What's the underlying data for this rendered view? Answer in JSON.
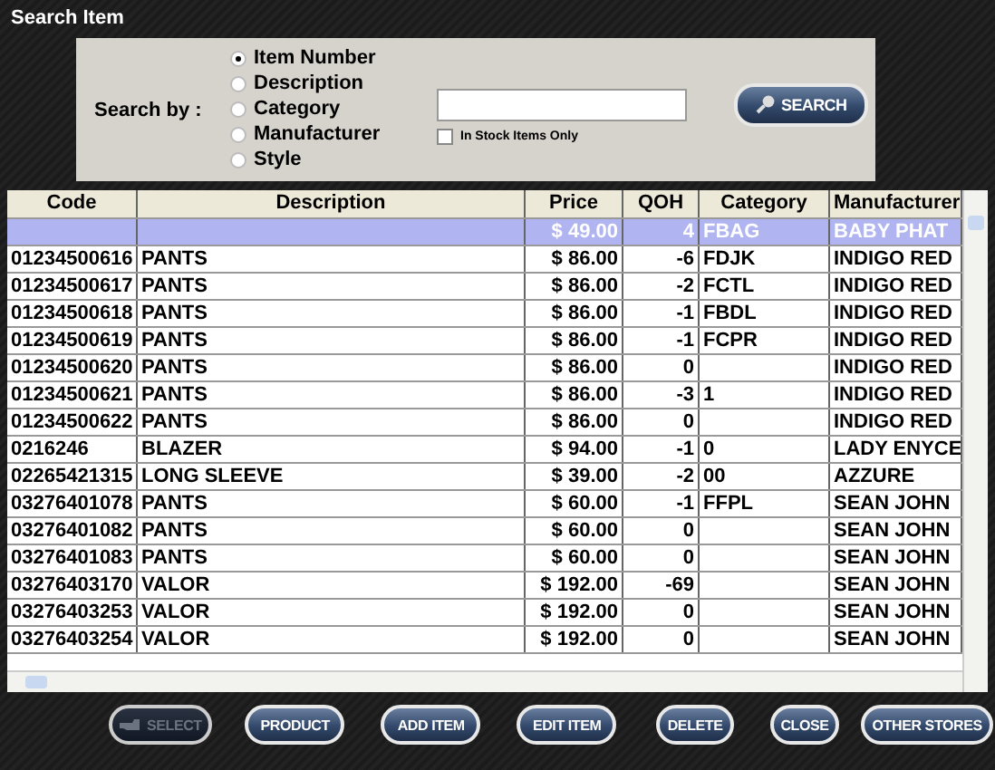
{
  "window": {
    "title": "Search Item"
  },
  "search": {
    "label": "Search by :",
    "options": [
      {
        "label": "Item Number",
        "selected": true
      },
      {
        "label": "Description",
        "selected": false
      },
      {
        "label": "Category",
        "selected": false
      },
      {
        "label": "Manufacturer",
        "selected": false
      },
      {
        "label": "Style",
        "selected": false
      }
    ],
    "in_stock_only": {
      "label": "In Stock Items Only",
      "checked": false
    },
    "button": "SEARCH"
  },
  "table": {
    "columns": [
      "Code",
      "Description",
      "Price",
      "QOH",
      "Category",
      "Manufacturer"
    ],
    "rows": [
      {
        "cells": [
          "",
          "",
          "$ 49.00",
          "4",
          "FBAG",
          "BABY PHAT"
        ],
        "selected": true
      },
      {
        "cells": [
          "01234500616",
          "PANTS",
          "$ 86.00",
          "-6",
          "FDJK",
          "INDIGO RED"
        ],
        "selected": false
      },
      {
        "cells": [
          "01234500617",
          "PANTS",
          "$ 86.00",
          "-2",
          "FCTL",
          "INDIGO RED"
        ],
        "selected": false
      },
      {
        "cells": [
          "01234500618",
          "PANTS",
          "$ 86.00",
          "-1",
          "FBDL",
          "INDIGO RED"
        ],
        "selected": false
      },
      {
        "cells": [
          "01234500619",
          "PANTS",
          "$ 86.00",
          "-1",
          "FCPR",
          "INDIGO RED"
        ],
        "selected": false
      },
      {
        "cells": [
          "01234500620",
          "PANTS",
          "$ 86.00",
          "0",
          "",
          "INDIGO RED"
        ],
        "selected": false
      },
      {
        "cells": [
          "01234500621",
          "PANTS",
          "$ 86.00",
          "-3",
          "1",
          "INDIGO RED"
        ],
        "selected": false
      },
      {
        "cells": [
          "01234500622",
          "PANTS",
          "$ 86.00",
          "0",
          "",
          "INDIGO RED"
        ],
        "selected": false
      },
      {
        "cells": [
          "0216246",
          "BLAZER",
          "$ 94.00",
          "-1",
          "0",
          "LADY ENYCE"
        ],
        "selected": false
      },
      {
        "cells": [
          "02265421315",
          "LONG SLEEVE",
          "$ 39.00",
          "-2",
          "00",
          "AZZURE"
        ],
        "selected": false
      },
      {
        "cells": [
          "03276401078",
          "PANTS",
          "$ 60.00",
          "-1",
          "FFPL",
          "SEAN JOHN"
        ],
        "selected": false
      },
      {
        "cells": [
          "03276401082",
          "PANTS",
          "$ 60.00",
          "0",
          "",
          "SEAN JOHN"
        ],
        "selected": false
      },
      {
        "cells": [
          "03276401083",
          "PANTS",
          "$ 60.00",
          "0",
          "",
          "SEAN JOHN"
        ],
        "selected": false
      },
      {
        "cells": [
          "03276403170",
          "VALOR",
          "$ 192.00",
          "-69",
          "",
          "SEAN JOHN"
        ],
        "selected": false
      },
      {
        "cells": [
          "03276403253",
          "VALOR",
          "$ 192.00",
          "0",
          "",
          "SEAN JOHN"
        ],
        "selected": false
      },
      {
        "cells": [
          "03276403254",
          "VALOR",
          "$ 192.00",
          "0",
          "",
          "SEAN JOHN"
        ],
        "selected": false
      }
    ]
  },
  "buttons": [
    {
      "label": "SELECT",
      "disabled": true
    },
    {
      "label": "PRODUCT",
      "disabled": false
    },
    {
      "label": "ADD ITEM",
      "disabled": false
    },
    {
      "label": "EDIT ITEM",
      "disabled": false
    },
    {
      "label": "DELETE",
      "disabled": false
    },
    {
      "label": "CLOSE",
      "disabled": false
    },
    {
      "label": "OTHER STORES",
      "disabled": false
    }
  ]
}
